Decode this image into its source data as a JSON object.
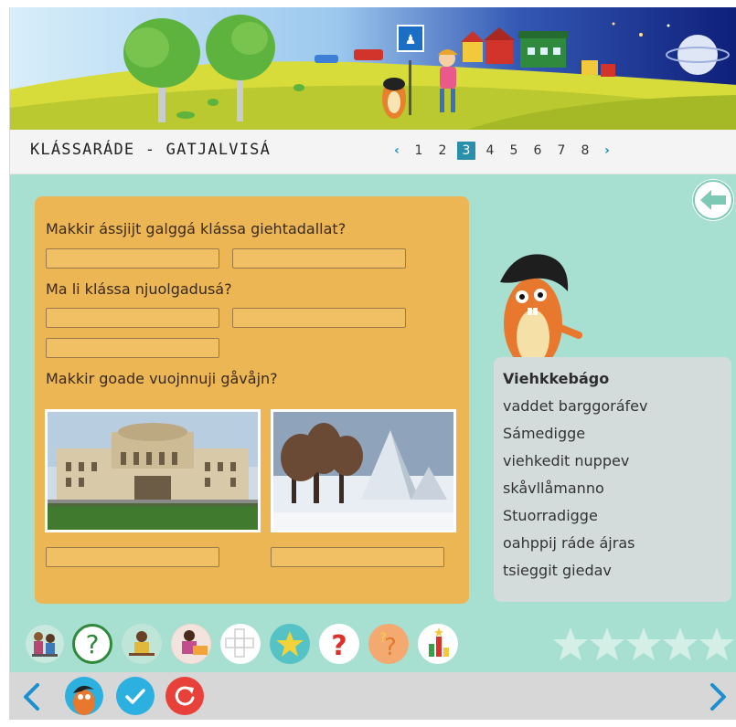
{
  "header": {
    "title": "KLÁSSARÁDE - GATJALVISÁ"
  },
  "pager": {
    "prev_label": "‹",
    "next_label": "›",
    "pages": [
      "1",
      "2",
      "3",
      "4",
      "5",
      "6",
      "7",
      "8"
    ],
    "current": "3"
  },
  "questions": {
    "q1": "Makkir ássjijt galggá klássa giehtadallat?",
    "q2": "Ma li klássa njuolgadusá?",
    "q3": "Makkir goade vuojnnuji gåvåjn?"
  },
  "inputs": {
    "q1_a": "",
    "q1_b": "",
    "q2_a": "",
    "q2_b": "",
    "q2_c": "",
    "photo1_answer": "",
    "photo2_answer": ""
  },
  "wordbank": {
    "title": "Viehkkebágo",
    "items": [
      "vaddet barggoráfev",
      "Sámedigge",
      "viehkedit nuppev",
      "skåvllåmanno",
      "Stuorradigge",
      "oahppij ráde ájras",
      "tsieggit giedav"
    ]
  },
  "toolbar": {
    "icons": [
      "reading-icon",
      "help-icon",
      "writing-icon",
      "teacher-icon",
      "crossword-icon",
      "star-icon",
      "question-icon",
      "quiz-icon",
      "chart-icon"
    ]
  },
  "rating": {
    "stars": 5,
    "filled": 0
  },
  "colors": {
    "accent": "#2a8fa8",
    "content_bg": "#a7dfd0",
    "card_bg": "#ecb655",
    "check_button": "#2bb0e0",
    "reset_button": "#e8413a"
  }
}
